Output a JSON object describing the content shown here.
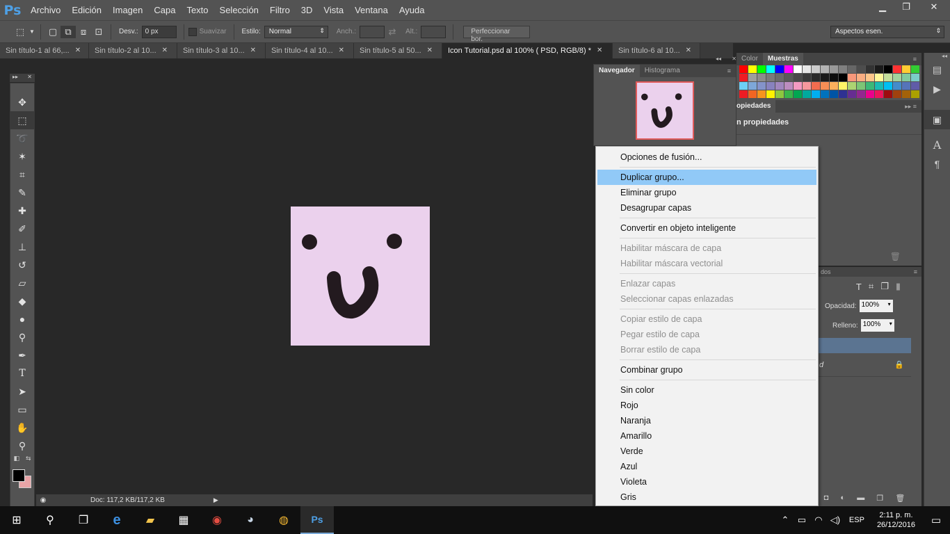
{
  "app": {
    "logo": "Ps"
  },
  "menu": [
    "Archivo",
    "Edición",
    "Imagen",
    "Capa",
    "Texto",
    "Selección",
    "Filtro",
    "3D",
    "Vista",
    "Ventana",
    "Ayuda"
  ],
  "window_controls": {
    "minimize": "▁",
    "restore": "❐",
    "close": "✕"
  },
  "options": {
    "desv_label": "Desv.:",
    "desv_value": "0 px",
    "suavizar": "Suavizar",
    "estilo_label": "Estilo:",
    "estilo_value": "Normal",
    "anch_label": "Anch.:",
    "alt_label": "Alt.:",
    "perfeccionar": "Perfeccionar bor.",
    "workspace": "Aspectos esen."
  },
  "tabs": [
    {
      "label": "Sin título-1 al 66,...",
      "active": false
    },
    {
      "label": "Sin título-2 al 10...",
      "active": false
    },
    {
      "label": "Sin título-3 al 10...",
      "active": false
    },
    {
      "label": "Sin título-4 al 10...",
      "active": false
    },
    {
      "label": "Sin título-5 al 50...",
      "active": false
    },
    {
      "label": "Icon Tutorial.psd al 100% ( PSD, RGB/8) *",
      "active": true
    },
    {
      "label": "Sin título-6 al 10...",
      "active": false
    }
  ],
  "tab_close": "✕",
  "status": {
    "doc": "Doc: 117,2 KB/117,2 KB"
  },
  "navigator": {
    "tab1": "Navegador",
    "tab2": "Histograma"
  },
  "swatches": {
    "tab1": "Color",
    "tab2": "Muestras"
  },
  "properties": {
    "tab": "opiedades",
    "subtitle": "n propiedades"
  },
  "layers": {
    "header": "dos",
    "opacity_label": "Opacidad:",
    "opacity_value": "100%",
    "fill_label": "Relleno:",
    "fill_value": "100%",
    "row_label": "d"
  },
  "context_menu": {
    "items": [
      {
        "label": "Opciones de fusión...",
        "disabled": false
      },
      {
        "label": "Duplicar grupo...",
        "disabled": false,
        "highlighted": true
      },
      {
        "label": "Eliminar grupo",
        "disabled": false
      },
      {
        "label": "Desagrupar capas",
        "disabled": false
      },
      {
        "label": "Convertir en objeto inteligente",
        "disabled": false
      },
      {
        "label": "Habilitar máscara de capa",
        "disabled": true
      },
      {
        "label": "Habilitar máscara vectorial",
        "disabled": true
      },
      {
        "label": "Enlazar capas",
        "disabled": true
      },
      {
        "label": "Seleccionar capas enlazadas",
        "disabled": true
      },
      {
        "label": "Copiar estilo de capa",
        "disabled": true
      },
      {
        "label": "Pegar estilo de capa",
        "disabled": true
      },
      {
        "label": "Borrar estilo de capa",
        "disabled": true
      },
      {
        "label": "Combinar grupo",
        "disabled": false
      },
      {
        "label": "Sin color",
        "disabled": false
      },
      {
        "label": "Rojo",
        "disabled": false
      },
      {
        "label": "Naranja",
        "disabled": false
      },
      {
        "label": "Amarillo",
        "disabled": false
      },
      {
        "label": "Verde",
        "disabled": false
      },
      {
        "label": "Azul",
        "disabled": false
      },
      {
        "label": "Violeta",
        "disabled": false
      },
      {
        "label": "Gris",
        "disabled": false
      }
    ]
  },
  "taskbar": {
    "time": "2:11 p. m.",
    "date": "26/12/2016",
    "lang": "ESP"
  },
  "colors": {
    "canvas_fill": "#ebd1ed",
    "face": "#231a1f",
    "menu_highlight": "#91c9f7",
    "ps_blue": "#4ea0e6"
  }
}
